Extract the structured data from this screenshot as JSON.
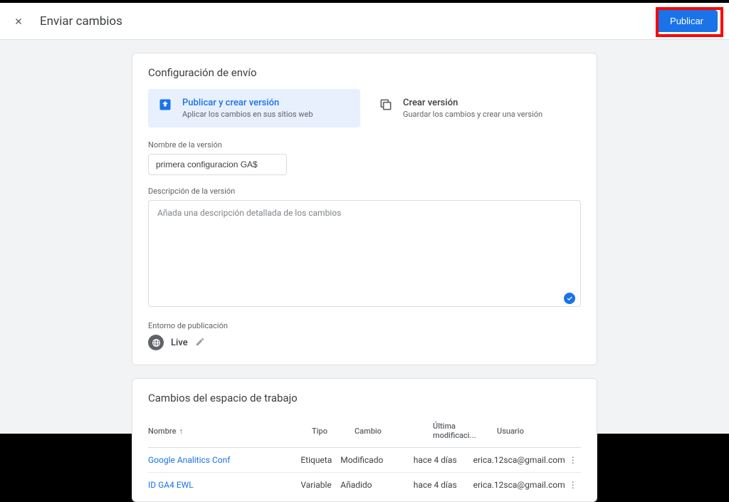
{
  "header": {
    "title": "Enviar cambios",
    "publish_button": "Publicar"
  },
  "config": {
    "section_title": "Configuración de envío",
    "option_publish": {
      "title": "Publicar y crear versión",
      "subtitle": "Aplicar los cambios en sus sitios web"
    },
    "option_version": {
      "title": "Crear versión",
      "subtitle": "Guardar los cambios y crear una versión"
    },
    "version_name_label": "Nombre de la versión",
    "version_name_value": "primera configuracion GA$",
    "version_desc_label": "Descripción de la versión",
    "version_desc_placeholder": "Añada una descripción detallada de los cambios",
    "env_label": "Entorno de publicación",
    "env_value": "Live"
  },
  "changes": {
    "section_title": "Cambios del espacio de trabajo",
    "columns": {
      "name": "Nombre",
      "type": "Tipo",
      "change": "Cambio",
      "modified": "Última modificaci...",
      "user": "Usuario"
    },
    "rows": [
      {
        "name": "Google Analitics Conf",
        "type": "Etiqueta",
        "change": "Modificado",
        "modified": "hace 4 días",
        "user": "erica.12sca@gmail.com"
      },
      {
        "name": "ID GA4 EWL",
        "type": "Variable",
        "change": "Añadido",
        "modified": "hace 4 días",
        "user": "erica.12sca@gmail.com"
      }
    ]
  }
}
